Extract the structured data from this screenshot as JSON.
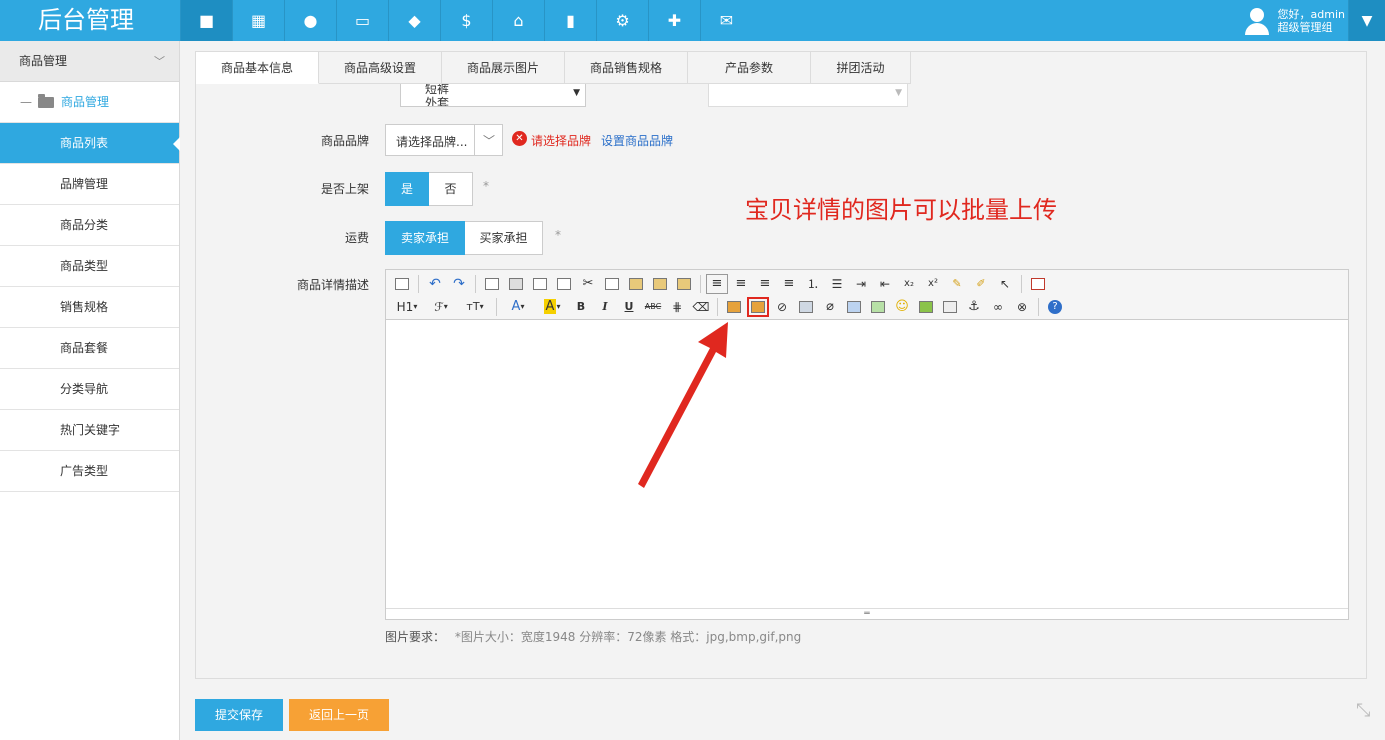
{
  "app": {
    "title": "后台管理"
  },
  "topnav": [
    {
      "icon": "bag-icon",
      "glyph": "⛯",
      "active": true
    },
    {
      "icon": "store-icon",
      "glyph": "▦"
    },
    {
      "icon": "user-icon",
      "glyph": "●"
    },
    {
      "icon": "monitor-icon",
      "glyph": "▭"
    },
    {
      "icon": "tag-icon",
      "glyph": "◆"
    },
    {
      "icon": "money-bag-icon",
      "glyph": "$"
    },
    {
      "icon": "home-icon",
      "glyph": "⌂"
    },
    {
      "icon": "bar-chart-icon",
      "glyph": "▮"
    },
    {
      "icon": "gear-icon",
      "glyph": "⚙"
    },
    {
      "icon": "puzzle-icon",
      "glyph": "✚"
    },
    {
      "icon": "chat-icon",
      "glyph": "✉"
    }
  ],
  "user": {
    "greeting": "您好，admin",
    "role": "超级管理组"
  },
  "sidebar": {
    "group": "商品管理",
    "sub": "商品管理",
    "items": [
      "商品列表",
      "品牌管理",
      "商品分类",
      "商品类型",
      "销售规格",
      "商品套餐",
      "分类导航",
      "热门关键字",
      "广告类型"
    ],
    "active_index": 0
  },
  "tabs": [
    "商品基本信息",
    "商品高级设置",
    "商品展示图片",
    "商品销售规格",
    "产品参数",
    "拼团活动"
  ],
  "form": {
    "category_partial_1": "短裤",
    "category_partial_2": "外套",
    "brand_label": "商品品牌",
    "brand_placeholder": "请选择品牌...",
    "brand_error": "请选择品牌",
    "brand_link": "设置商品品牌",
    "onsale_label": "是否上架",
    "onsale_yes": "是",
    "onsale_no": "否",
    "freight_label": "运费",
    "freight_seller": "卖家承担",
    "freight_buyer": "买家承担",
    "required_mark": "*",
    "detail_label": "商品详情描述",
    "img_req_label": "图片要求：",
    "img_req_value": "*图片大小：宽度1948 分辨率：72像素 格式：jpg,bmp,gif,png"
  },
  "toolbar_text": {
    "h1": "H1",
    "font": "ℱ",
    "size": "тT",
    "fontcolor": "A",
    "bgcolor": "A",
    "bold": "B",
    "italic": "I",
    "underline": "U",
    "strike": "ABC"
  },
  "annotation": "宝贝详情的图片可以批量上传",
  "buttons": {
    "submit": "提交保存",
    "back": "返回上一页"
  },
  "colors": {
    "primary": "#2fa8e0",
    "orange": "#f7a135",
    "error": "#e0281f"
  }
}
